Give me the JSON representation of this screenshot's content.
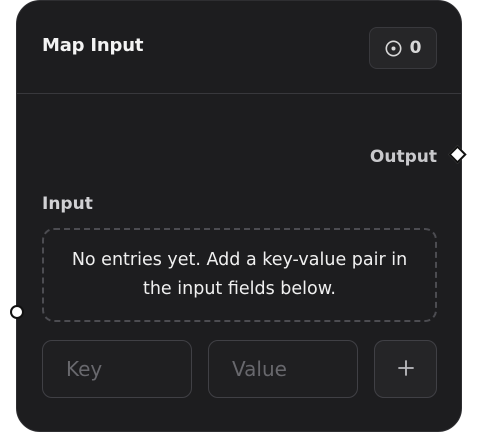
{
  "node": {
    "title": "Map Input",
    "badge": {
      "icon": "circle-dot-icon",
      "count": "0"
    },
    "output": {
      "label": "Output"
    },
    "input": {
      "label": "Input",
      "empty_message": "No entries yet. Add a key-value pair in the input fields below.",
      "key_placeholder": "Key",
      "value_placeholder": "Value",
      "add_icon": "plus-icon"
    }
  },
  "colors": {
    "node_background": "#1d1d1f",
    "text_primary": "#f3f3f3",
    "text_muted": "#c9c9cc",
    "handle": "#ffffff"
  }
}
